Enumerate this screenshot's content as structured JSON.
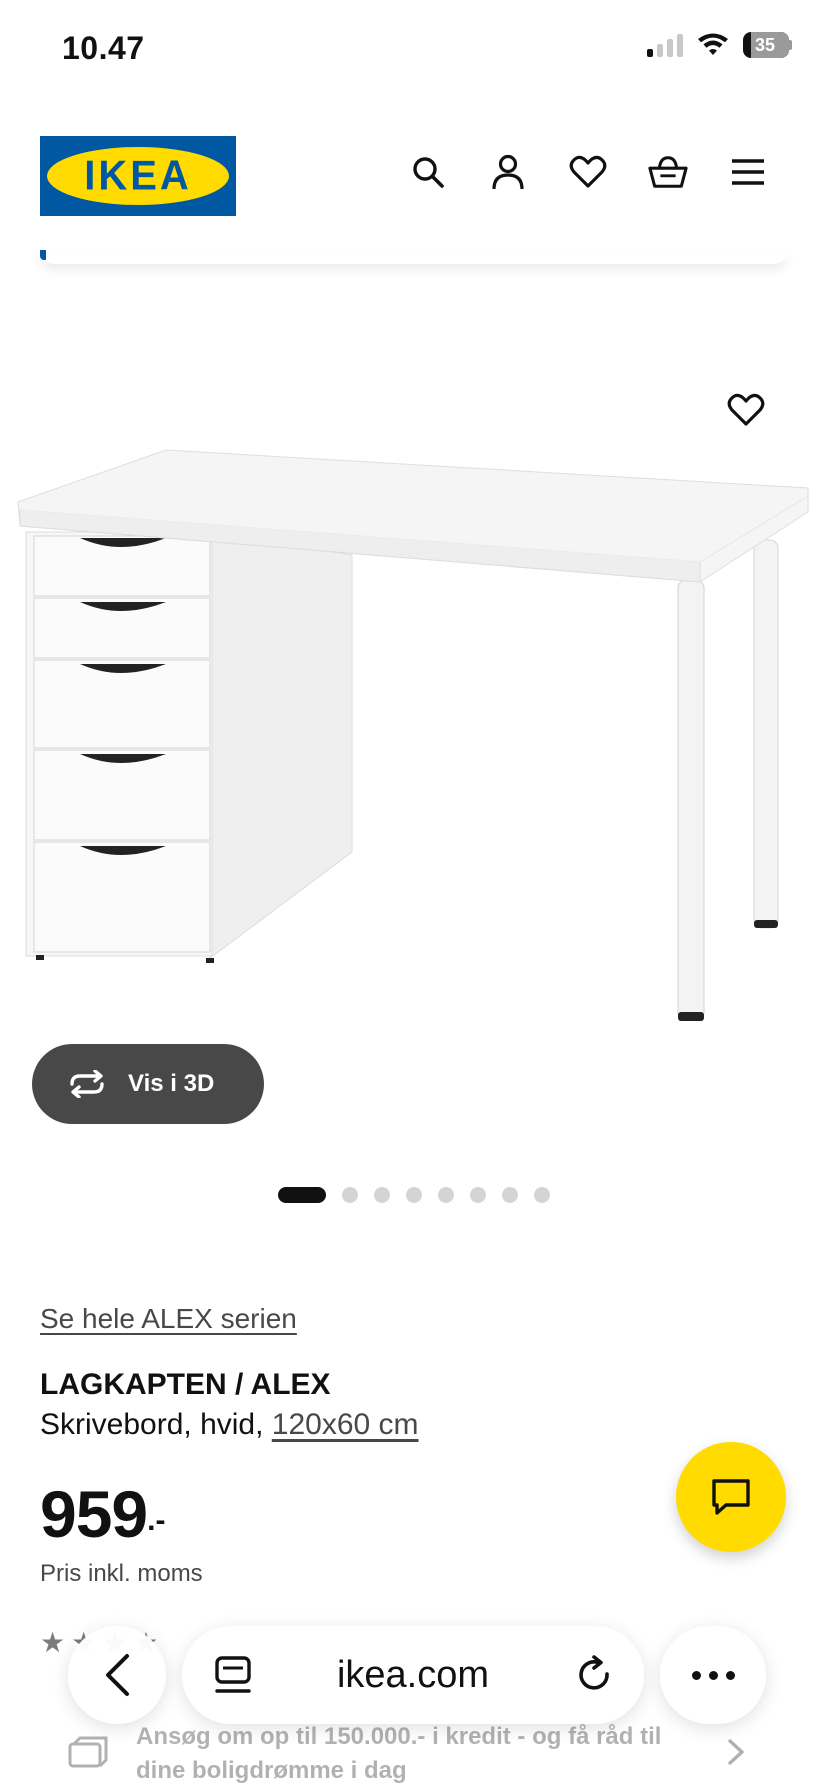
{
  "status_bar": {
    "time": "10.47",
    "battery": "35"
  },
  "header": {
    "logo_text": "IKEA",
    "icons": [
      "search-icon",
      "profile-icon",
      "heart-icon",
      "basket-icon",
      "menu-icon"
    ]
  },
  "product": {
    "series_link": "Se hele ALEX serien",
    "name": "LAGKAPTEN / ALEX",
    "description_prefix": "Skrivebord, hvid, ",
    "size": "120x60 cm",
    "price": "959",
    "price_suffix": ".-",
    "price_note": "Pris inkl. moms",
    "view_3d_label": "Vis i 3D",
    "image_count": 8,
    "active_image": 1
  },
  "browser": {
    "url": "ikea.com"
  },
  "credit_banner": {
    "line1": "Ansøg om op til 150.000.- i kredit - og få råd til",
    "line2": "dine boligdrømme i dag"
  },
  "colors": {
    "ikea_blue": "#0058a3",
    "ikea_yellow": "#ffdb00",
    "dark_pill": "#484848"
  }
}
